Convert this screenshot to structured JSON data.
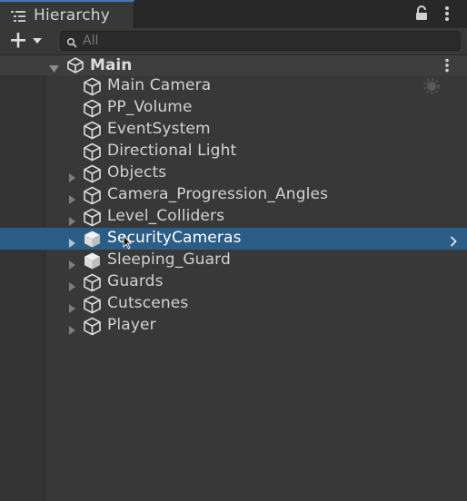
{
  "window": {
    "tab_title": "Hierarchy"
  },
  "toolbar": {
    "search_placeholder": "All"
  },
  "scene": {
    "name": "Main"
  },
  "items": [
    {
      "label": "Main Camera",
      "has_children": false,
      "selected": false
    },
    {
      "label": "PP_Volume",
      "has_children": false,
      "selected": false
    },
    {
      "label": "EventSystem",
      "has_children": false,
      "selected": false
    },
    {
      "label": "Directional Light",
      "has_children": false,
      "selected": false
    },
    {
      "label": "Objects",
      "has_children": true,
      "selected": false
    },
    {
      "label": "Camera_Progression_Angles",
      "has_children": true,
      "selected": false
    },
    {
      "label": "Level_Colliders",
      "has_children": true,
      "selected": false
    },
    {
      "label": "SecurityCameras",
      "has_children": true,
      "selected": true
    },
    {
      "label": "Sleeping_Guard",
      "has_children": true,
      "selected": false
    },
    {
      "label": "Guards",
      "has_children": true,
      "selected": false
    },
    {
      "label": "Cutscenes",
      "has_children": true,
      "selected": false
    },
    {
      "label": "Player",
      "has_children": true,
      "selected": false
    }
  ],
  "colors": {
    "selection": "#2c5d87",
    "tab_accent": "#3a79bb",
    "background": "#383838"
  },
  "icons": {
    "tab": "hierarchy-list-icon",
    "lock": "lock-icon",
    "menu": "kebab-menu-icon",
    "create": "plus-icon",
    "search": "search-icon",
    "scene": "unity-logo-icon",
    "gameobject": "cube-icon",
    "light_gizmo": "gear-icon"
  }
}
